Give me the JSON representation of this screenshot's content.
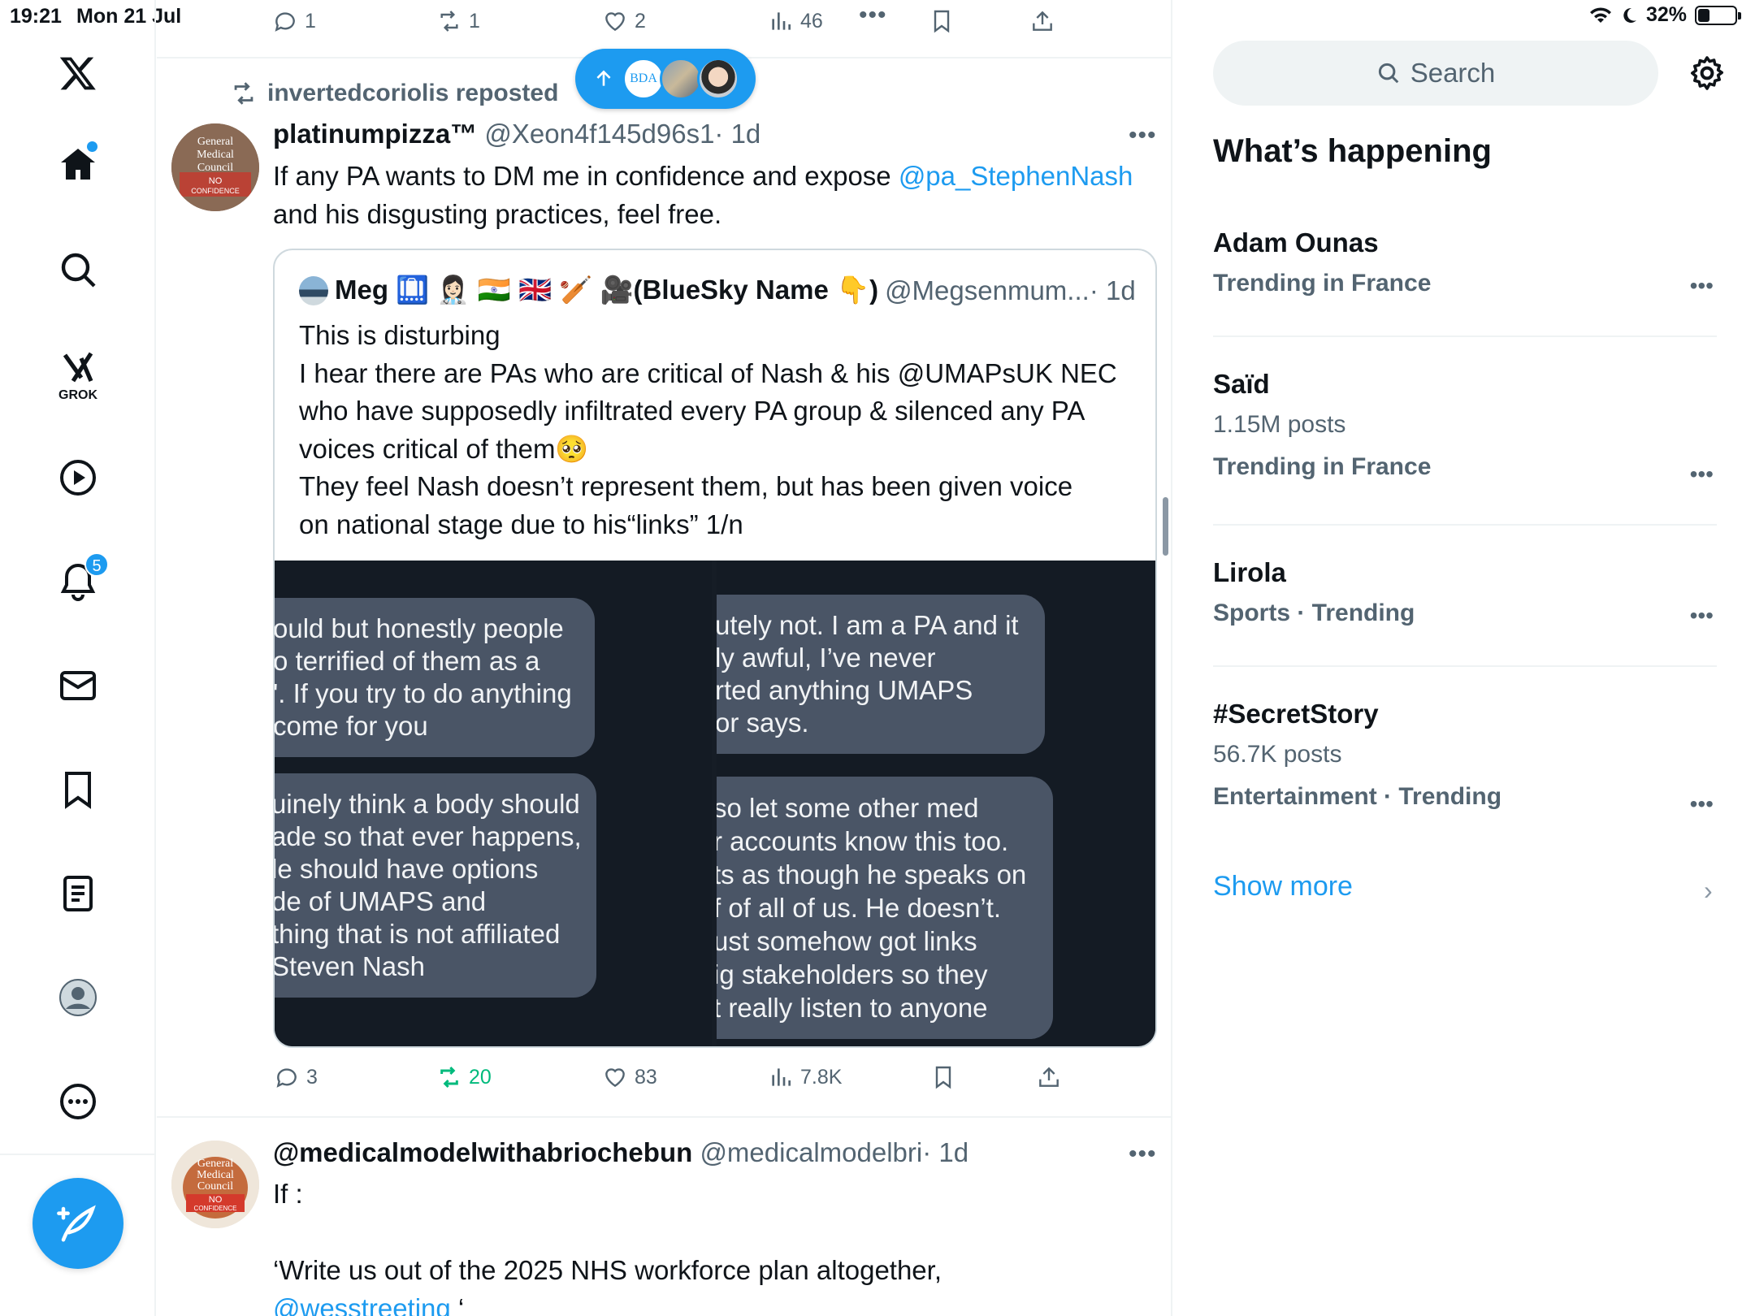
{
  "status_bar": {
    "time": "19:21",
    "date": "Mon 21 Jul",
    "battery": "32%",
    "battery_level": 0.32
  },
  "nav": {
    "notifications_badge": "5"
  },
  "top_tweet_actions": {
    "replies": "1",
    "reposts": "1",
    "likes": "2",
    "views": "46"
  },
  "new_posts_pill": {
    "avatar_label": "BDA"
  },
  "tweet1": {
    "repost_label": "invertedcoriolis reposted",
    "name": "platinumpizza™",
    "handle": "@Xeon4f145d96s1",
    "time": "· 1d",
    "text_before": "If any PA wants to DM me in confidence and expose ",
    "mention": "@pa_StephenNash",
    "text_after": " and his disgusting practices, feel free.",
    "avatar_lines": [
      "General",
      "Medical",
      "Council",
      "NO",
      "CONFIDENCE"
    ],
    "quote": {
      "name": "Meg 🛄 👩🏻‍⚕️ 🇮🇳 🇬🇧 🏏 🎥(BlueSky Name 👇)",
      "handle": "@Megsenmum...",
      "time": "· 1d",
      "lines": [
        "This is disturbing",
        "I hear there are PAs who are critical of Nash & his @UMAPsUK  NEC",
        "who have supposedly infiltrated every PA group & silenced any PA",
        "voices critical of them🥺",
        "They feel Nash doesn’t represent them, but has been given voice",
        "on national stage due to his“links” 1/n"
      ],
      "image_left": {
        "bubble1": [
          "ould but honestly people",
          "o terrified of them as a",
          "'. If you try to do anything",
          "come for you"
        ],
        "bubble2": [
          "uinely think a body should",
          "ade so that ever happens,",
          "le should have options",
          "de of UMAPS and",
          "thing that is not affiliated",
          "Steven Nash"
        ]
      },
      "image_right": {
        "bubble1": [
          "utely not. I am a PA and it",
          "ly awful, I’ve never",
          "rted anything UMAPS",
          "or says."
        ],
        "bubble2": [
          "so let some other med",
          "r accounts know this too.",
          "ts as though he speaks on",
          "f of all of us. He doesn’t.",
          "ust somehow got links",
          "ig stakeholders so they",
          "t really listen to anyone"
        ]
      }
    },
    "actions": {
      "replies": "3",
      "reposts": "20",
      "likes": "83",
      "views": "7.8K"
    }
  },
  "tweet2": {
    "name": "@medicalmodelwithabriochebun",
    "handle": "@medicalmodelbri",
    "time": "· 1d",
    "line1": "If :",
    "line2": "‘Write us out of the 2025 NHS workforce plan altogether,",
    "mention": "@wesstreeting",
    "after_mention": " ‘",
    "avatar_lines": [
      "General",
      "Medical",
      "Council",
      "NO",
      "CONFIDENCE"
    ]
  },
  "sidebar": {
    "search_placeholder": "Search",
    "title": "What’s happening",
    "trends": [
      {
        "name": "Adam Ounas",
        "posts": "",
        "context": "Trending in France"
      },
      {
        "name": "Saïd",
        "posts": "1.15M posts",
        "context": "Trending in France"
      },
      {
        "name": "Lirola",
        "posts": "",
        "context": "Sports · Trending"
      },
      {
        "name": "#SecretStory",
        "posts": "56.7K posts",
        "context": "Entertainment · Trending"
      }
    ],
    "show_more": "Show more"
  },
  "colors": {
    "accent": "#1d9bf0",
    "repost_active": "#00ba7c",
    "muted": "#536471",
    "border": "#eff3f4"
  },
  "icons": [
    "x-logo-icon",
    "home-icon",
    "search-icon",
    "grok-icon",
    "video-icon",
    "bell-icon",
    "mail-icon",
    "bookmark-icon",
    "list-icon",
    "profile-icon",
    "more-circle-icon",
    "compose-icon",
    "reply-icon",
    "repost-icon",
    "like-icon",
    "views-icon",
    "share-icon",
    "gear-icon",
    "chevron-right-icon"
  ]
}
